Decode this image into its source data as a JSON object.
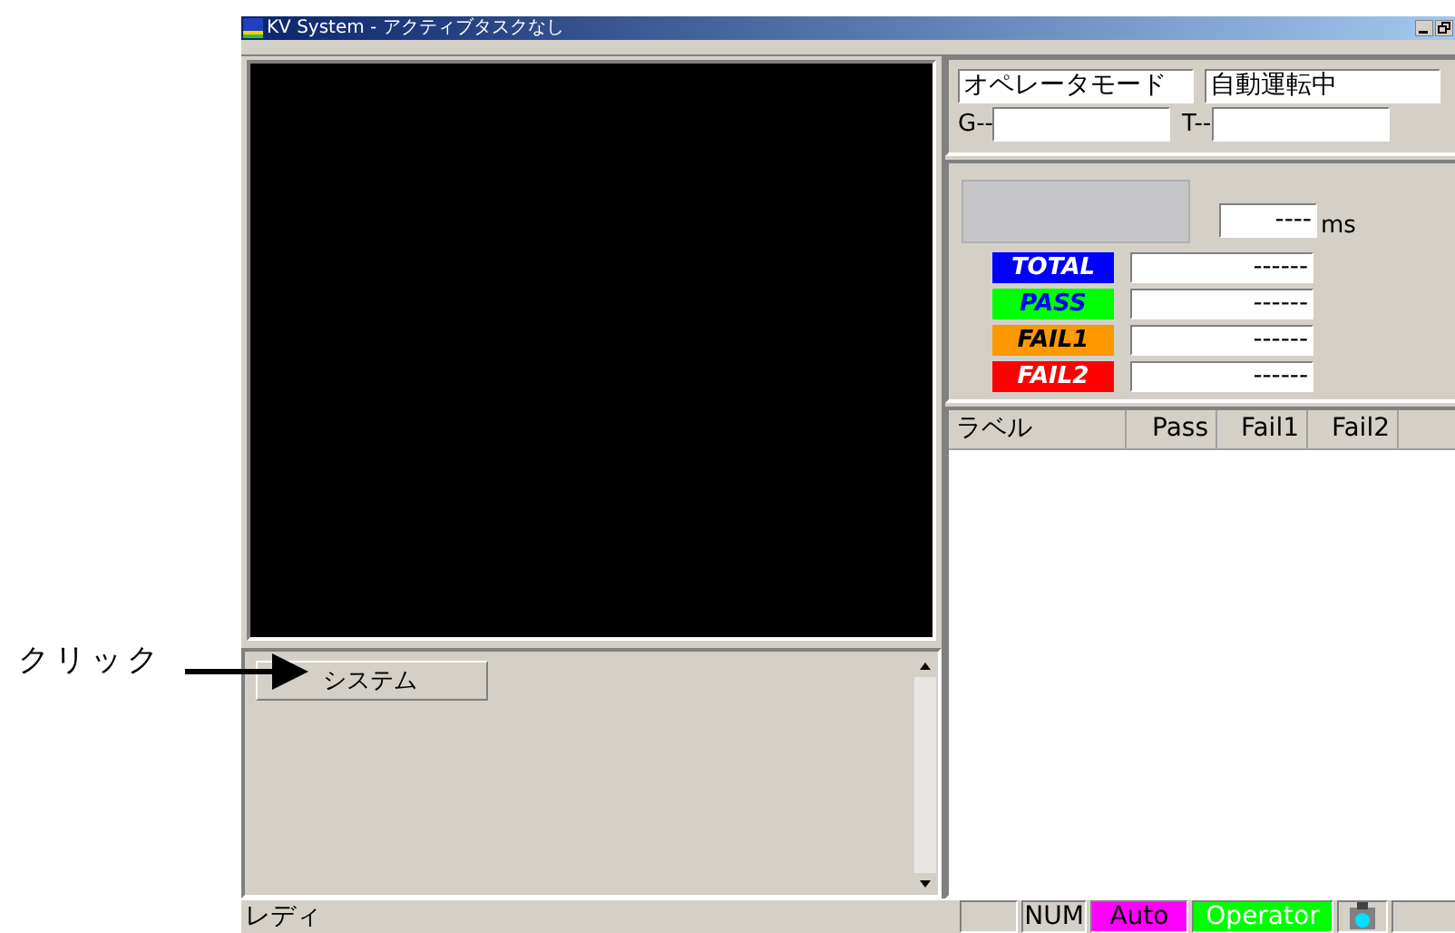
{
  "annotation": {
    "label": "クリック"
  },
  "window": {
    "title": "KV System - アクティブタスクなし"
  },
  "operator_panel": {
    "mode": "オペレータモード",
    "state": "自動運転中",
    "g_label": "G--",
    "t_label": "T--"
  },
  "timing": {
    "value": "----",
    "unit": "ms"
  },
  "counters": [
    {
      "label": "TOTAL",
      "color": "#0000ff",
      "kind": "inverse",
      "value": "------"
    },
    {
      "label": "PASS",
      "color": "#00ff00",
      "kind": "accent",
      "value": "------"
    },
    {
      "label": "FAIL1",
      "color": "#ff9900",
      "kind": "plain",
      "value": "------"
    },
    {
      "label": "FAIL2",
      "color": "#ff0000",
      "kind": "inverse",
      "value": "------"
    }
  ],
  "table": {
    "columns": [
      "ラベル",
      "Pass",
      "Fail1",
      "Fail2"
    ]
  },
  "system_button": {
    "label": "システム"
  },
  "status_bar": {
    "message": "レディ",
    "panes": [
      {
        "kind": "empty"
      },
      {
        "kind": "text",
        "text": "NUM"
      },
      {
        "kind": "plain",
        "text": "Auto",
        "color": "#ff00ff"
      },
      {
        "kind": "inverse",
        "text": "Operator",
        "color": "#00ff00"
      },
      {
        "kind": "icon"
      },
      {
        "kind": "empty"
      }
    ]
  }
}
